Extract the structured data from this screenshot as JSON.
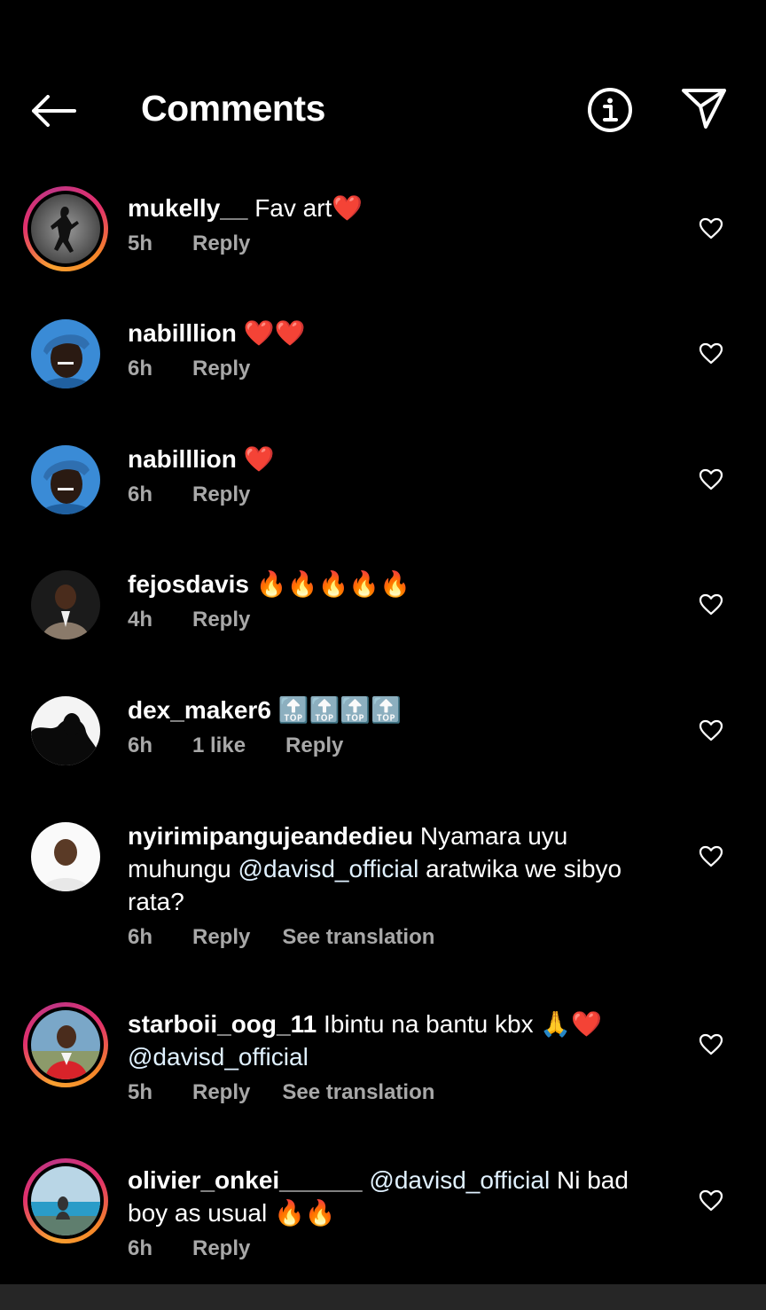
{
  "header": {
    "title": "Comments",
    "back_icon": "arrow-left-icon",
    "info_icon": "info-circle-icon",
    "send_icon": "paper-plane-icon"
  },
  "comments": [
    {
      "username": "mukelly__",
      "text": "Fav art❤️",
      "time": "5h",
      "likes": "",
      "reply": "Reply",
      "translate": "",
      "story_ring": true
    },
    {
      "username": "nabilllion",
      "text": "❤️❤️",
      "time": "6h",
      "likes": "",
      "reply": "Reply",
      "translate": "",
      "story_ring": false
    },
    {
      "username": "nabilllion",
      "text": "❤️",
      "time": "6h",
      "likes": "",
      "reply": "Reply",
      "translate": "",
      "story_ring": false
    },
    {
      "username": "fejosdavis",
      "text": "🔥🔥🔥🔥🔥",
      "time": "4h",
      "likes": "",
      "reply": "Reply",
      "translate": "",
      "story_ring": false
    },
    {
      "username": "dex_maker6",
      "text": "🔝🔝🔝🔝",
      "time": "6h",
      "likes": "1 like",
      "reply": "Reply",
      "translate": "",
      "story_ring": false
    },
    {
      "username": "nyirimipangujeandedieu",
      "text_before": "Nyamara uyu muhungu",
      "mention": "@davisd_official",
      "text_after": "aratwika we sibyo rata?",
      "time": "6h",
      "likes": "",
      "reply": "Reply",
      "translate": "See translation",
      "story_ring": false
    },
    {
      "username": "starboii_oog_11",
      "text_before": "Ibintu na bantu kbx 🙏❤️",
      "mention": "@davisd_official",
      "text_after": "",
      "time": "5h",
      "likes": "",
      "reply": "Reply",
      "translate": "See translation",
      "story_ring": true
    },
    {
      "username": "olivier_onkei______",
      "text_before": "",
      "mention": "@davisd_official",
      "text_after": "Ni bad boy as usual 🔥🔥",
      "time": "6h",
      "likes": "",
      "reply": "Reply",
      "translate": "",
      "story_ring": true
    }
  ],
  "icons": {
    "like": "heart-outline-icon"
  },
  "colors": {
    "background": "#000000",
    "secondary_text": "#a8a8a8",
    "mention": "#e0f1ff",
    "story_ring_start": "#f9a130",
    "story_ring_end": "#c13584"
  }
}
